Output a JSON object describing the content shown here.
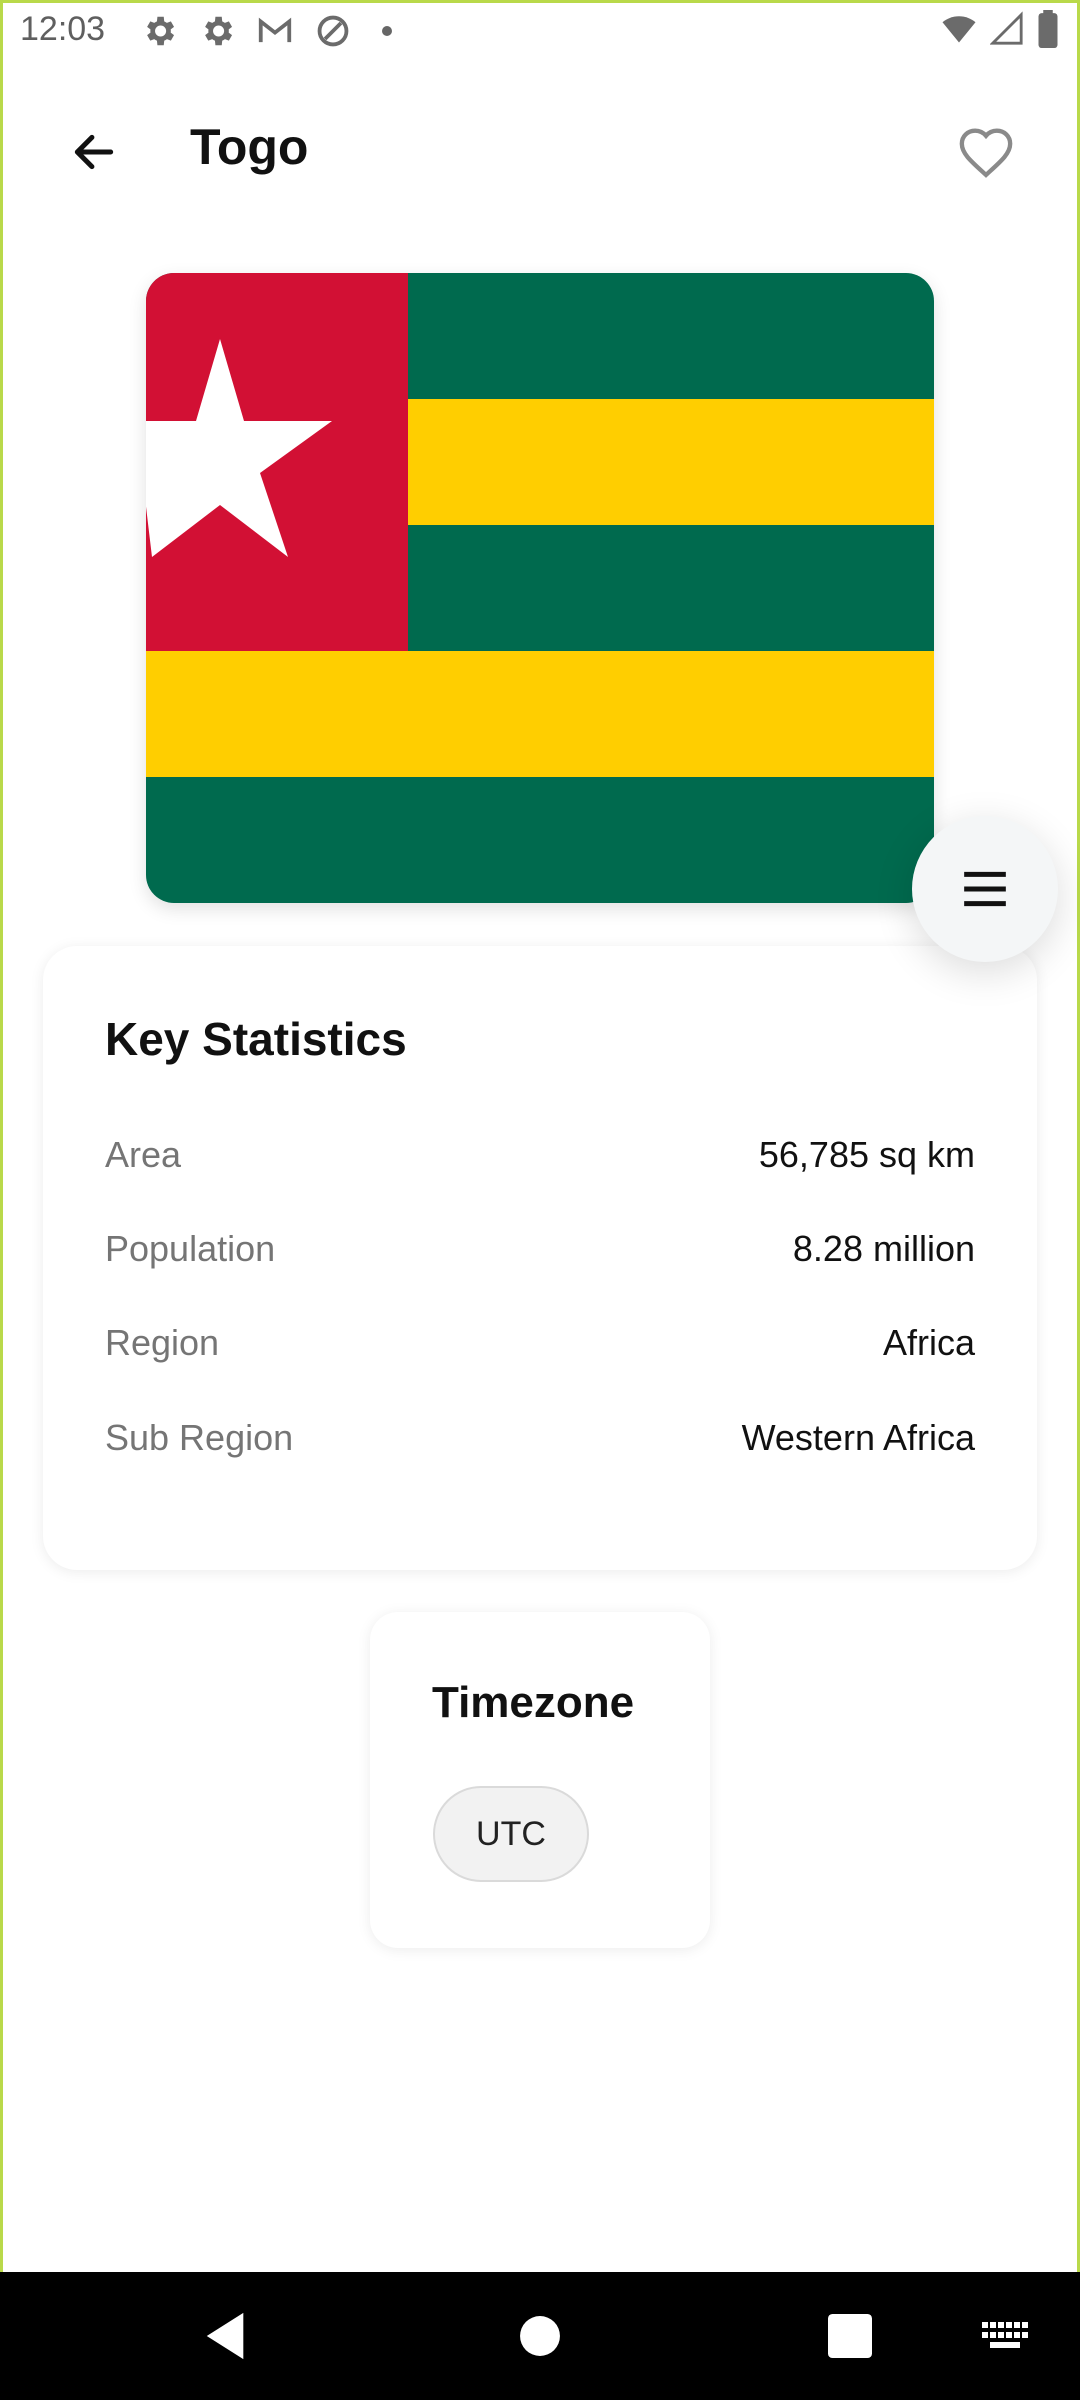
{
  "status_bar": {
    "time": "12:03",
    "left_icons": [
      "settings-icon",
      "settings-icon",
      "gmail-icon",
      "at-sign-icon",
      "dot-icon"
    ],
    "right_icons": [
      "wifi-icon",
      "signal-icon",
      "battery-icon"
    ]
  },
  "app_bar": {
    "title": "Togo",
    "back_icon": "arrow-left-icon",
    "favorite_icon": "heart-outline-icon"
  },
  "flag": {
    "country": "Togo",
    "colors": {
      "green": "#006a4e",
      "yellow": "#ffce00",
      "red": "#d21034",
      "white": "#ffffff"
    }
  },
  "fab": {
    "icon": "menu-icon"
  },
  "key_statistics": {
    "title": "Key Statistics",
    "rows": [
      {
        "label": "Area",
        "value": "56,785 sq km"
      },
      {
        "label": "Population",
        "value": "8.28 million"
      },
      {
        "label": "Region",
        "value": "Africa"
      },
      {
        "label": "Sub Region",
        "value": "Western Africa"
      }
    ]
  },
  "timezone": {
    "title": "Timezone",
    "chips": [
      "UTC"
    ]
  },
  "nav_bar": {
    "buttons": [
      "back-triangle-icon",
      "home-circle-icon",
      "recents-square-icon",
      "keyboard-icon"
    ]
  }
}
